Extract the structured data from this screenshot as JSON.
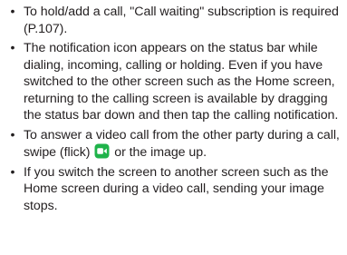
{
  "bullet_glyph": "•",
  "items": [
    {
      "text": "To hold/add a call, \"Call waiting\" subscription is required (P.107)."
    },
    {
      "text": "The notification icon appears on the status bar while dialing, incoming, calling or holding. Even if you have switched to the other screen such as the Home screen, returning to the calling screen is available by dragging the status bar down and then tap the calling notification."
    },
    {
      "text_before": "To answer a video call from the other party during a call, swipe (flick)",
      "icon": "video-call-icon",
      "text_after": "or the image up."
    },
    {
      "text": "If you switch the screen to another screen such as the Home screen during a video call, sending your image stops."
    }
  ],
  "colors": {
    "text": "#231f20",
    "icon_fill": "#1fb34a",
    "icon_glyph": "#ffffff"
  }
}
